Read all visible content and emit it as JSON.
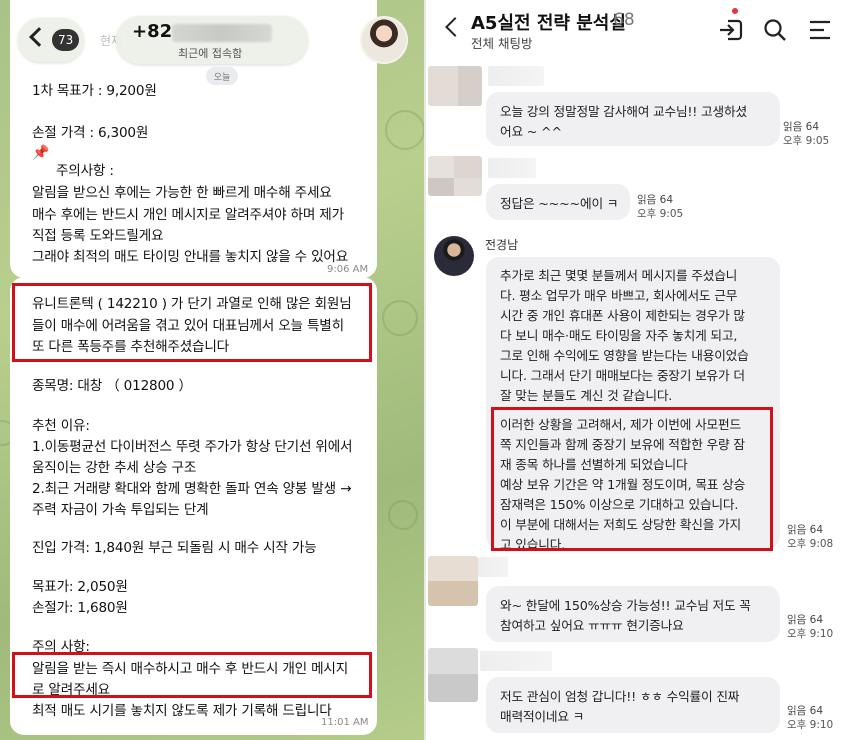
{
  "left": {
    "back_count": "73",
    "contact_prefix": "+82",
    "last_seen": "최근에 접속함",
    "behind_text": "현재",
    "today_badge": "오늘",
    "top_lines": [
      "1차 목표가 : 9,200원",
      "손절 가격 : 6,300원",
      "주의사항 :",
      "알림을 받으신 후에는 가능한 한 빠르게 매수해 주세요",
      "매수 후에는 반드시 개인 메시지로 알려주셔야 하며 제가",
      "직접 등록 도와드릴게요",
      "그래야 최적의 매도 타이밍 안내를 놓치지 않을 수 있어요"
    ],
    "top_time": "9:06 AM",
    "pin_icon": "pushpin-icon",
    "bottom_lines": [
      "유니트론텍 ( 142210 ) 가 단기 과열로 인해 많은 회원님",
      "들이 매수에 어려움을 겪고 있어 대표님께서 오늘 특별히",
      "또 다른 폭등주를 추천해주셨습니다",
      "종목명: 대창 （ 012800 ）",
      "추천 이유:",
      "1.이동평균선 다이버전스 뚜렷 주가가 항상 단기선 위에서",
      "움직이는 강한 추세 상승 구조",
      "2.최근 거래량 확대와 함께 명확한 돌파 연속 양봉 발생 →",
      "주력 자금이 가속 투입되는 단계",
      "진입 가격: 1,840원 부근 되돌림 시 매수 시작 가능",
      "목표가: 2,050원",
      "손절가: 1,680원",
      "주의 사항:",
      "알림을 받는 즉시 매수하시고 매수 후 반드시 개인 메시지",
      "로 알려주세요",
      "최적 매도 시기를 놓치지 않도록 제가 기록해 드립니다"
    ],
    "bottom_time": "11:01 AM"
  },
  "right": {
    "title": "A5실전 전략 분석실",
    "member_count": "68",
    "subtitle": "전체 채팅방",
    "messages": [
      {
        "lines": [
          "오늘 강의 정말정말 감사해여 교수님!! 고생하셨",
          "어요 ~ ^^"
        ],
        "read": "읽음 64",
        "time": "오후 9:05"
      },
      {
        "lines": [
          "정답은 ~~~~에이 ㅋ"
        ],
        "read": "읽음 64",
        "time": "오후 9:05"
      },
      {
        "sender": "전경남",
        "lines": [
          "추가로 최근 몇몇 분들께서 메시지를 주셨습니",
          "다. 평소 업무가 매우 바쁘고, 회사에서도 근무",
          "시간 중 개인 휴대폰 사용이 제한되는 경우가 많",
          "다 보니 매수·매도 타이밍을 자주 놓치게 되고,",
          "그로 인해 수익에도 영향을 받는다는 내용이었습",
          "니다. 그래서 단기 매매보다는 중장기 보유가 더",
          "잘 맞는 분들도 계신 것 같습니다.",
          "이러한 상황을 고려해서, 제가 이번에 사모펀드",
          "쪽 지인들과 함께 중장기 보유에 적합한 우량 잠",
          "재 종목 하나를 선별하게 되었습니다",
          "예상 보유 기간은 약 1개월 정도이며, 목표 상승",
          "잠재력은 150% 이상으로 기대하고 있습니다.",
          "이 부분에 대해서는 저희도 상당한 확신을 가지",
          "고 있습니다."
        ],
        "read": "읽음 64",
        "time": "오후 9:08"
      },
      {
        "lines": [
          "와~ 한달에 150%상승 가능성!! 교수님 저도 꼭",
          "참여하고 싶어요 ㅠㅠㅠ 현기증나요"
        ],
        "read": "읽음 64",
        "time": "오후 9:10"
      },
      {
        "lines": [
          "저도 관심이 엄청 갑니다!! ㅎㅎ 수익률이 진짜",
          "매력적이네요 ㅋ"
        ],
        "read": "읽음 64",
        "time": "오후 9:10"
      }
    ],
    "icons": [
      "back-chevron-icon",
      "enter-room-icon",
      "search-icon",
      "menu-icon"
    ]
  }
}
